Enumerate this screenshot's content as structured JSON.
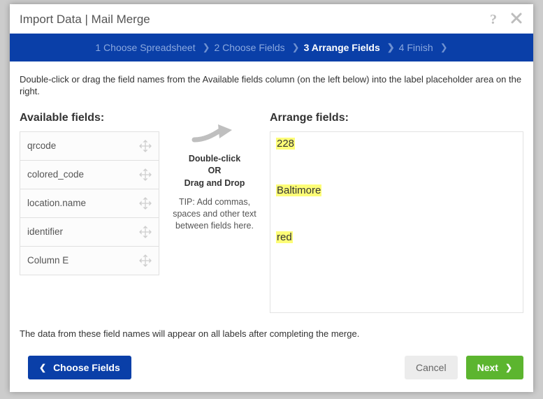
{
  "modal": {
    "title": "Import Data | Mail Merge"
  },
  "steps": {
    "s1": "1 Choose Spreadsheet",
    "s2": "2 Choose Fields",
    "s3": "3 Arrange Fields",
    "s4": "4 Finish"
  },
  "instructions": "Double-click or drag the field names from the Available fields column (on the left below) into the label placeholder area on the right.",
  "available": {
    "title": "Available fields:",
    "items": {
      "0": "qrcode",
      "1": "colored_code",
      "2": "location.name",
      "3": "identifier",
      "4": "Column E"
    }
  },
  "middle": {
    "line1": "Double-click",
    "line2": "OR",
    "line3": "Drag and Drop",
    "tip": "TIP: Add commas, spaces and other text between fields here."
  },
  "arrange": {
    "title": "Arrange fields:",
    "placed": {
      "0": "228",
      "1": "Baltimore",
      "2": "red"
    }
  },
  "footer_note": "The data from these field names will appear on all labels after completing the merge.",
  "buttons": {
    "back": "Choose Fields",
    "cancel": "Cancel",
    "next": "Next"
  }
}
